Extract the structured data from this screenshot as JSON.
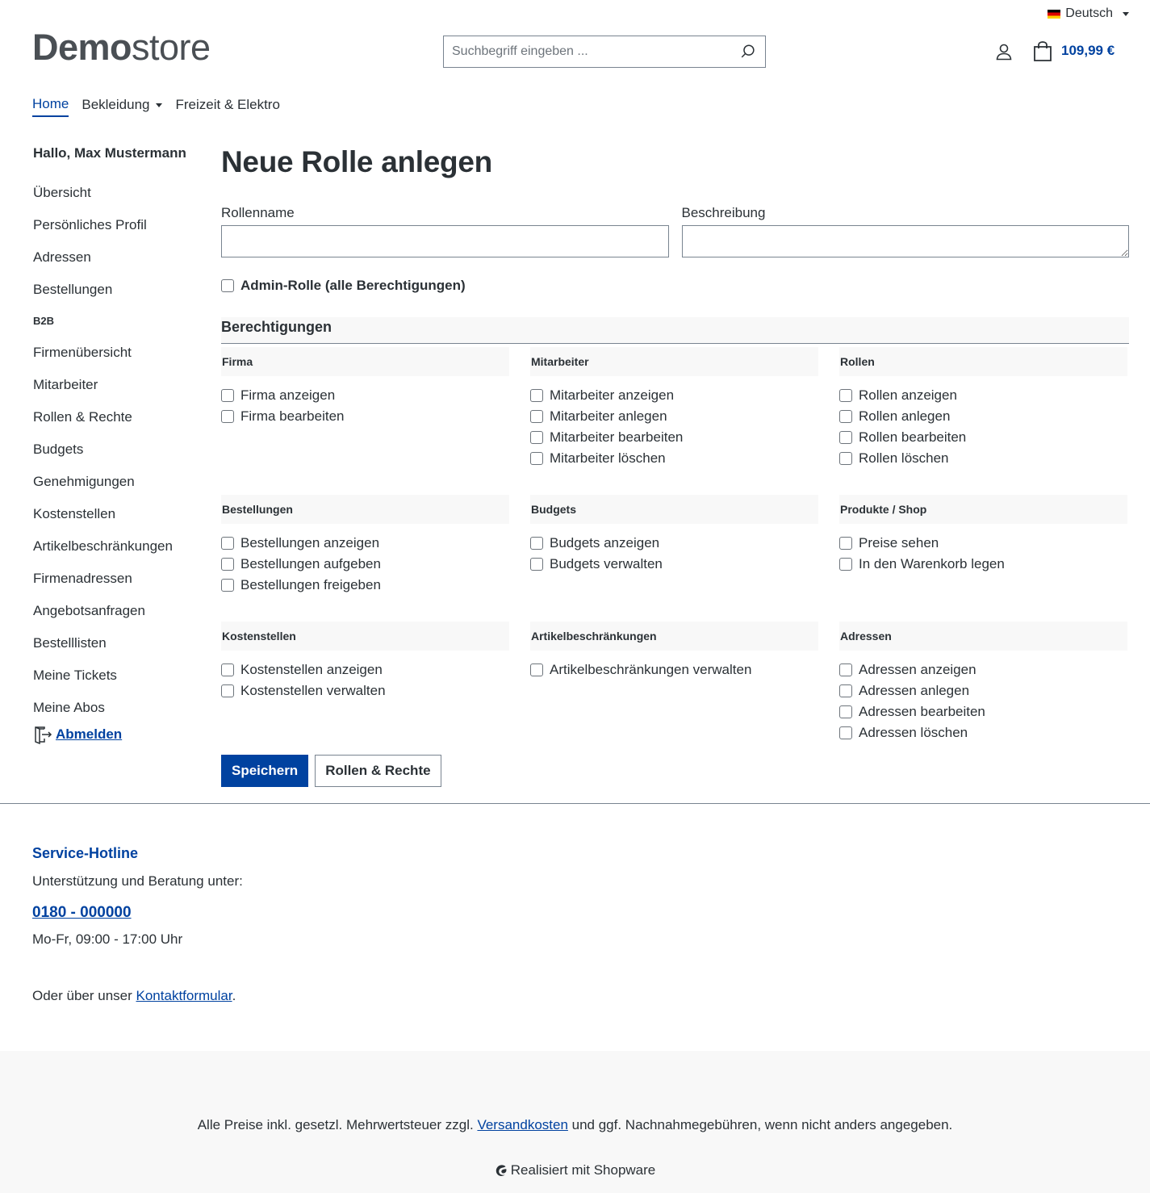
{
  "header": {
    "language": "Deutsch",
    "logo_bold": "Demo",
    "logo_thin": "store",
    "search_placeholder": "Suchbegriff eingeben ...",
    "cart_total": "109,99 €"
  },
  "nav": {
    "items": [
      {
        "label": "Home",
        "active": true
      },
      {
        "label": "Bekleidung",
        "has_dropdown": true
      },
      {
        "label": "Freizeit & Elektro"
      }
    ]
  },
  "sidebar": {
    "greeting": "Hallo, Max Mustermann",
    "items": [
      "Übersicht",
      "Persönliches Profil",
      "Adressen",
      "Bestellungen"
    ],
    "b2b_heading": "B2B",
    "b2b_items": [
      "Firmenübersicht",
      "Mitarbeiter",
      "Rollen & Rechte",
      "Budgets",
      "Genehmigungen",
      "Kostenstellen",
      "Artikelbeschränkungen",
      "Firmenadressen",
      "Angebotsanfragen",
      "Bestelllisten",
      "Meine Tickets",
      "Meine Abos"
    ],
    "logout": "Abmelden"
  },
  "main": {
    "title": "Neue Rolle anlegen",
    "role_name_label": "Rollenname",
    "role_name_value": "",
    "description_label": "Beschreibung",
    "description_value": "",
    "admin_label": "Admin-Rolle (alle Berechtigungen)",
    "permissions_title": "Berechtigungen",
    "groups": [
      {
        "title": "Firma",
        "items": [
          "Firma anzeigen",
          "Firma bearbeiten"
        ]
      },
      {
        "title": "Mitarbeiter",
        "items": [
          "Mitarbeiter anzeigen",
          "Mitarbeiter anlegen",
          "Mitarbeiter bearbeiten",
          "Mitarbeiter löschen"
        ]
      },
      {
        "title": "Rollen",
        "items": [
          "Rollen anzeigen",
          "Rollen anlegen",
          "Rollen bearbeiten",
          "Rollen löschen"
        ]
      },
      {
        "title": "Bestellungen",
        "items": [
          "Bestellungen anzeigen",
          "Bestellungen aufgeben",
          "Bestellungen freigeben"
        ]
      },
      {
        "title": "Budgets",
        "items": [
          "Budgets anzeigen",
          "Budgets verwalten"
        ]
      },
      {
        "title": "Produkte / Shop",
        "items": [
          "Preise sehen",
          "In den Warenkorb legen"
        ]
      },
      {
        "title": "Kostenstellen",
        "items": [
          "Kostenstellen anzeigen",
          "Kostenstellen verwalten"
        ]
      },
      {
        "title": "Artikelbeschränkungen",
        "items": [
          "Artikelbeschränkungen verwalten"
        ]
      },
      {
        "title": "Adressen",
        "items": [
          "Adressen anzeigen",
          "Adressen anlegen",
          "Adressen bearbeiten",
          "Adressen löschen"
        ]
      }
    ],
    "save_button": "Speichern",
    "roles_button": "Rollen & Rechte"
  },
  "footer": {
    "hotline_title": "Service-Hotline",
    "hotline_sub": "Unterstützung und Beratung unter:",
    "phone": "0180 - 000000",
    "hours": "Mo-Fr, 09:00 - 17:00 Uhr",
    "contact_prefix": "Oder über unser ",
    "contact_link": "Kontaktformular",
    "contact_suffix": ".",
    "vat_prefix": "Alle Preise inkl. gesetzl. Mehrwertsteuer zzgl. ",
    "vat_link": "Versandkosten",
    "vat_suffix": " und ggf. Nachnahmegebühren, wenn nicht anders angegeben.",
    "powered": "Realisiert mit Shopware"
  },
  "colors": {
    "accent": "#0042a0",
    "text": "#2b3136",
    "border": "#798490",
    "panel": "#f8f8f8"
  }
}
